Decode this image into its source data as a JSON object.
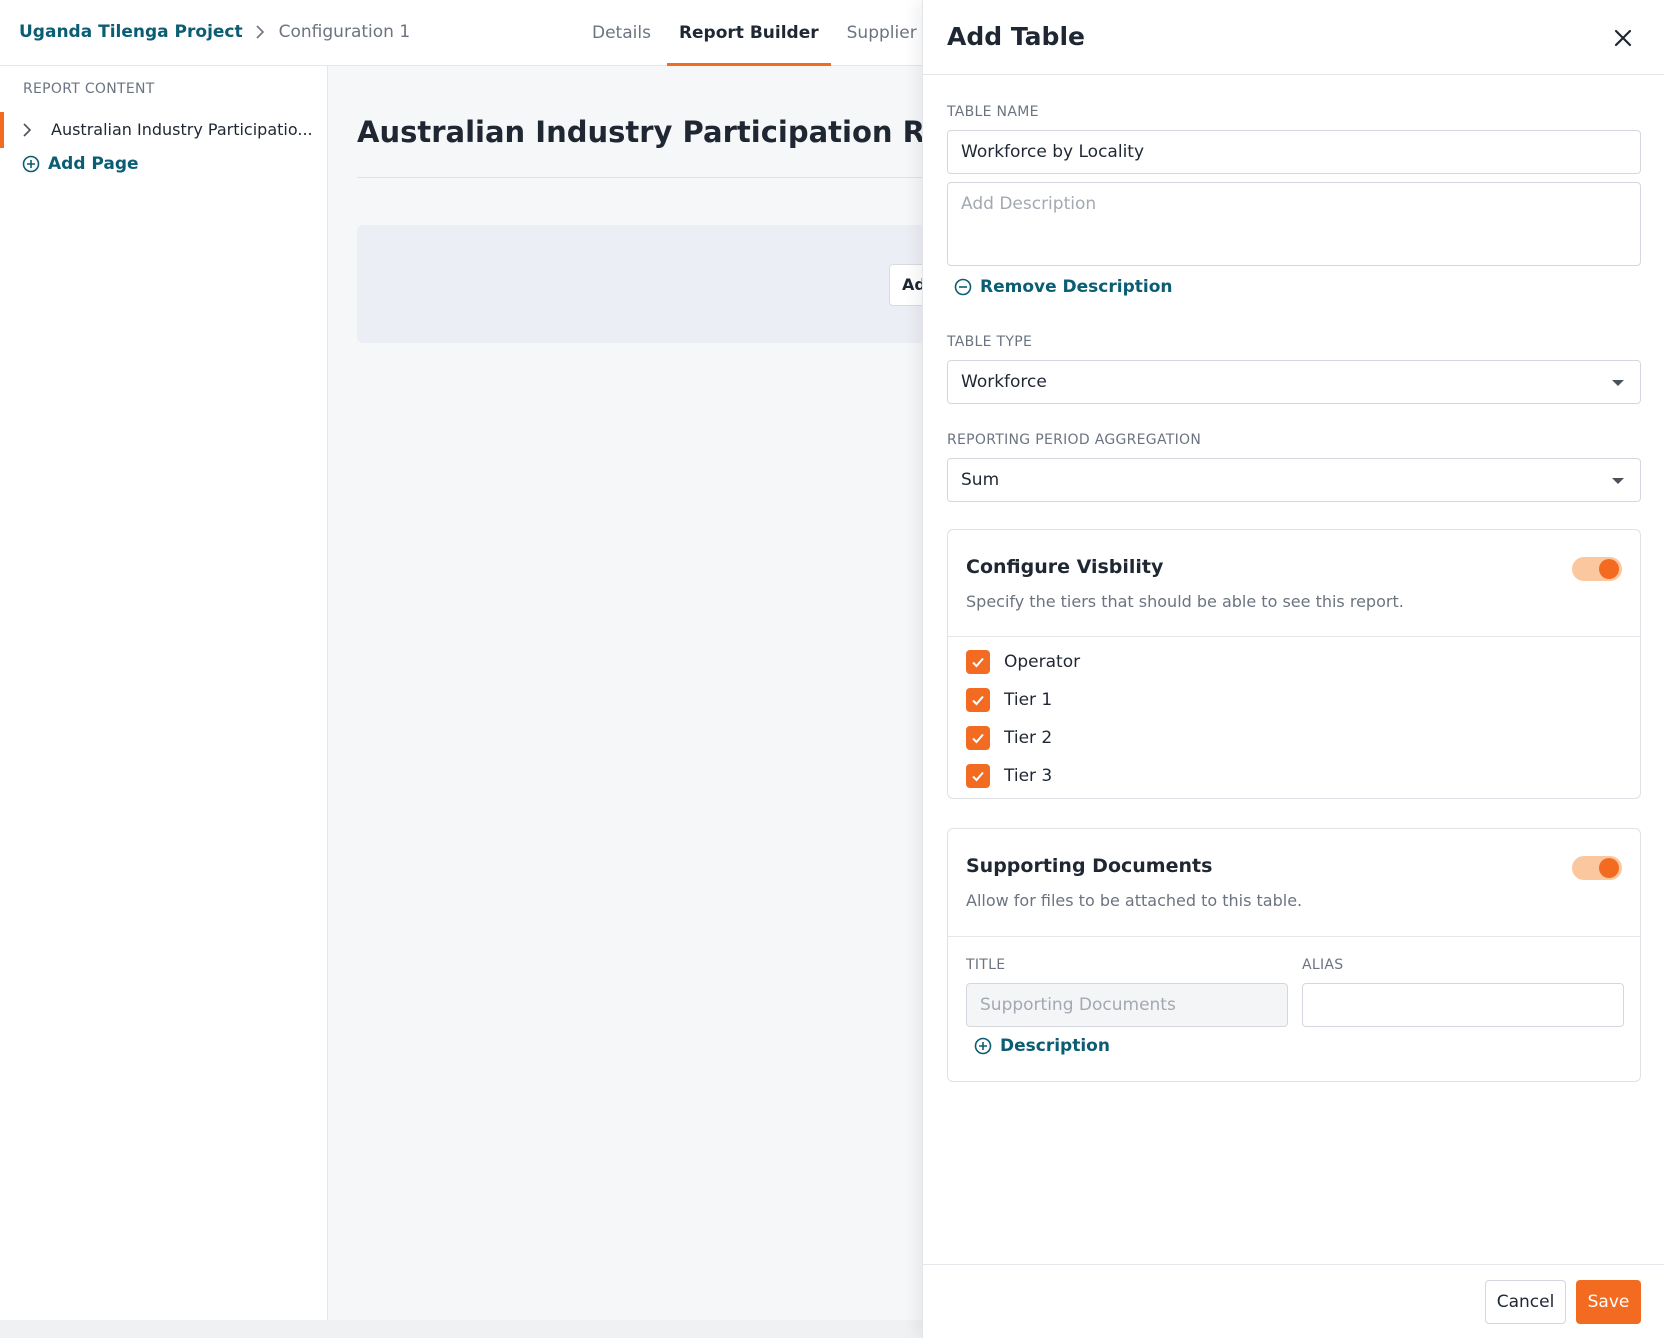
{
  "breadcrumb": {
    "project": "Uganda Tilenga Project",
    "current": "Configuration 1"
  },
  "tabs": [
    {
      "label": "Details",
      "active": false
    },
    {
      "label": "Report Builder",
      "active": true
    },
    {
      "label": "Supplier Setu",
      "active": false
    }
  ],
  "sidebar": {
    "heading": "REPORT CONTENT",
    "items": [
      {
        "label": "Australian Industry Participatio..."
      }
    ],
    "add_page_label": "Add Page"
  },
  "main": {
    "title": "Australian Industry Participation Reporti",
    "card_button_label": "Ad"
  },
  "drawer": {
    "title": "Add Table",
    "table_name": {
      "label": "TABLE NAME",
      "value": "Workforce by Locality"
    },
    "description": {
      "placeholder": "Add Description",
      "remove_label": "Remove Description"
    },
    "table_type": {
      "label": "TABLE TYPE",
      "value": "Workforce"
    },
    "aggregation": {
      "label": "REPORTING PERIOD AGGREGATION",
      "value": "Sum"
    },
    "visibility": {
      "title": "Configure Visbility",
      "description": "Specify the tiers that should be able to see this report.",
      "enabled": true,
      "tiers": [
        {
          "label": "Operator",
          "checked": true
        },
        {
          "label": "Tier 1",
          "checked": true
        },
        {
          "label": "Tier 2",
          "checked": true
        },
        {
          "label": "Tier 3",
          "checked": true
        }
      ]
    },
    "supporting_documents": {
      "title": "Supporting Documents",
      "description": "Allow for files to be attached to this table.",
      "enabled": true,
      "title_label": "TITLE",
      "title_placeholder": "Supporting Documents",
      "alias_label": "ALIAS",
      "alias_value": "",
      "add_description_label": "Description"
    },
    "footer": {
      "cancel_label": "Cancel",
      "save_label": "Save"
    }
  },
  "colors": {
    "accent": "#f26b21",
    "link": "#0b5d73",
    "toggle_track": "#fbc79f"
  },
  "icons": [
    "chevron-right-icon",
    "plus-circle-icon",
    "minus-circle-icon",
    "close-icon",
    "caret-down-icon",
    "checkmark-icon"
  ]
}
